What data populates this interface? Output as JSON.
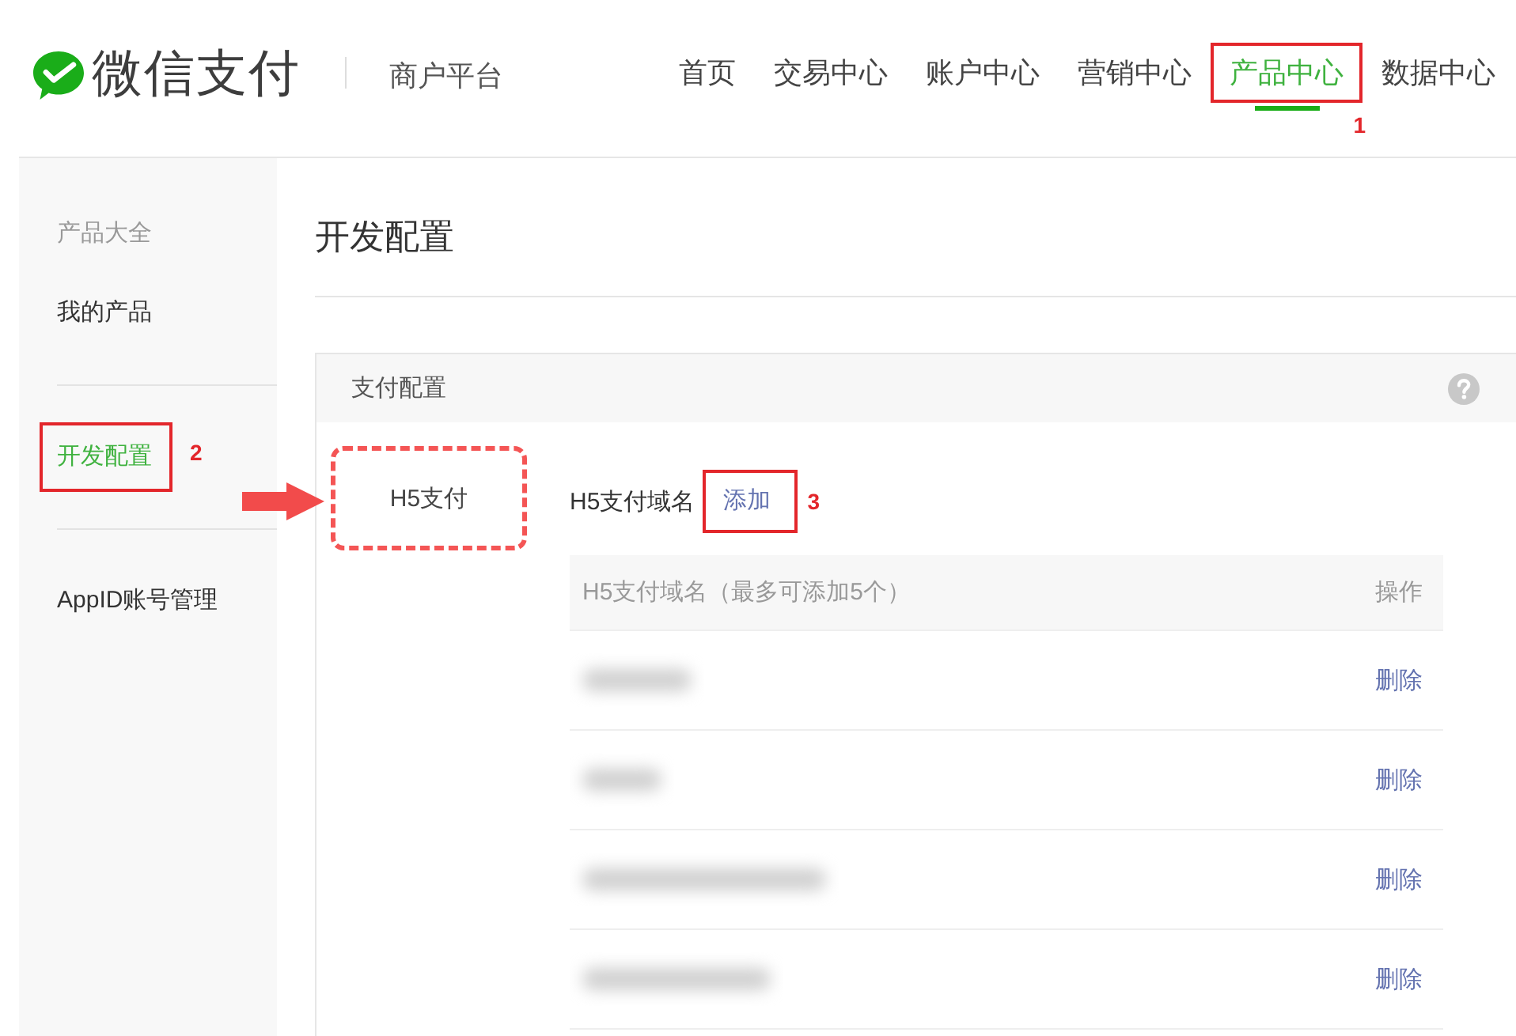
{
  "header": {
    "logo_text": "微信支付",
    "platform": "商户平台",
    "nav": [
      {
        "label": "首页",
        "selected": false
      },
      {
        "label": "交易中心",
        "selected": false
      },
      {
        "label": "账户中心",
        "selected": false
      },
      {
        "label": "营销中心",
        "selected": false
      },
      {
        "label": "产品中心",
        "selected": true,
        "callout": "1"
      },
      {
        "label": "数据中心",
        "selected": false
      }
    ]
  },
  "sidebar": {
    "groups": [
      {
        "items": [
          {
            "kind": "heading",
            "label": "产品大全"
          },
          {
            "kind": "link",
            "label": "我的产品",
            "selected": false
          }
        ]
      },
      {
        "items": [
          {
            "kind": "link",
            "label": "开发配置",
            "selected": true,
            "callout": "2"
          }
        ]
      },
      {
        "items": [
          {
            "kind": "link",
            "label": "AppID账号管理",
            "selected": false
          }
        ]
      }
    ]
  },
  "main": {
    "title": "开发配置",
    "panel": {
      "title": "支付配置",
      "products": [
        {
          "label": "H5支付",
          "highlighted": true
        }
      ],
      "domain_section": {
        "label": "H5支付域名",
        "add_link": {
          "label": "添加",
          "callout": "3"
        },
        "table": {
          "columns": [
            "H5支付域名（最多可添加5个）",
            "操作"
          ],
          "rows": [
            {
              "redacted": true,
              "action": "删除"
            },
            {
              "redacted": true,
              "action": "删除"
            },
            {
              "redacted": true,
              "action": "删除"
            },
            {
              "redacted": true,
              "action": "删除"
            }
          ]
        }
      }
    }
  }
}
